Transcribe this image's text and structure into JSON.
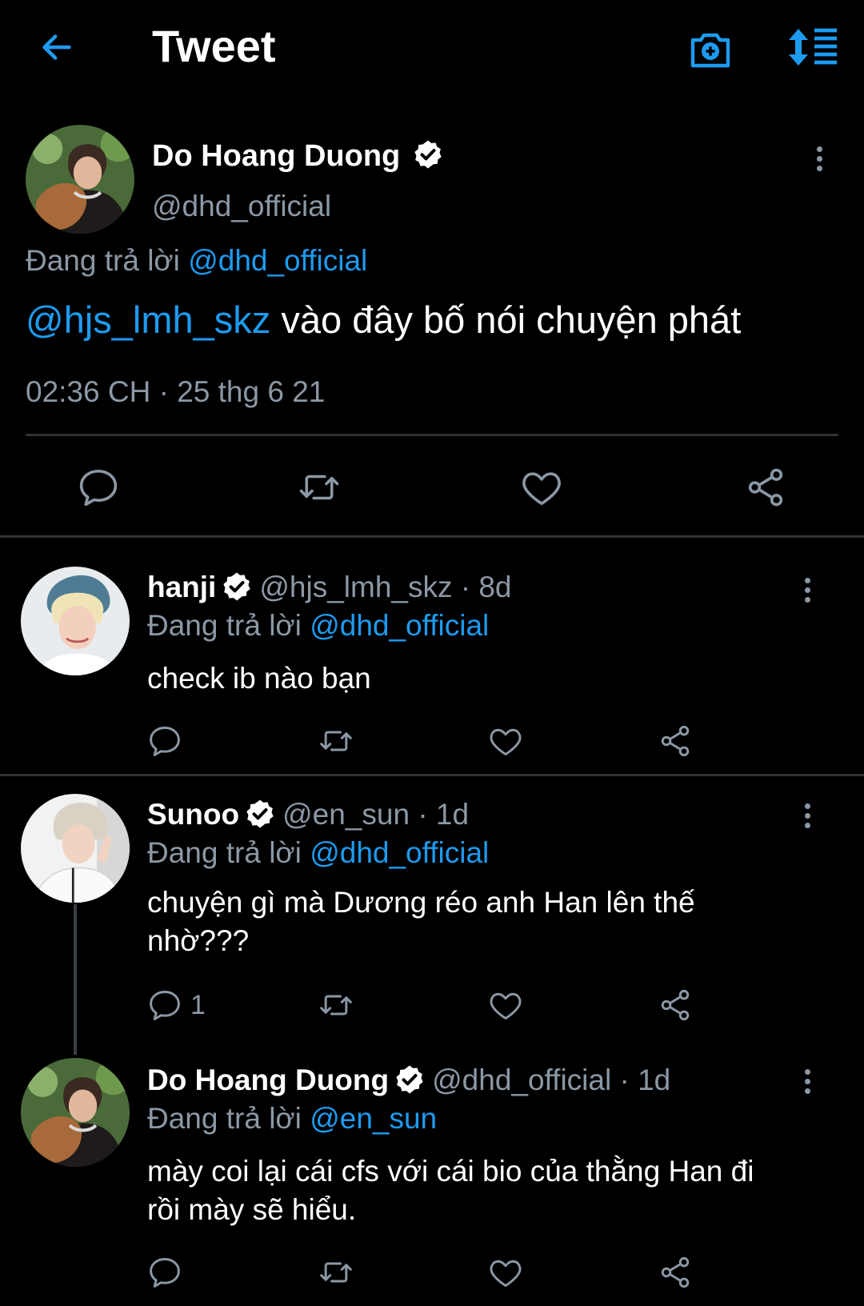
{
  "header": {
    "title": "Tweet"
  },
  "main_tweet": {
    "author_name": "Do Hoang Duong",
    "handle": "@dhd_official",
    "reply_prefix": "Đang trả lời",
    "reply_to": "@dhd_official",
    "mention": "@hjs_lmh_skz",
    "text": " vào đây bố nói chuyện phát",
    "timestamp": "02:36 CH · 25 thg 6 21"
  },
  "replies": [
    {
      "author_name": "hanji",
      "meta": "@hjs_lmh_skz · 8d",
      "reply_prefix": "Đang trả lời",
      "reply_to": "@dhd_official",
      "text_line1": "check ib nào bạn",
      "text_line2": "",
      "reply_count": ""
    },
    {
      "author_name": "Sunoo",
      "meta": "@en_sun · 1d",
      "reply_prefix": "Đang trả lời",
      "reply_to": "@dhd_official",
      "text_line1": "chuyện gì mà Dương réo anh Han lên thế",
      "text_line2": "nhờ???",
      "reply_count": "1"
    },
    {
      "author_name": "Do Hoang Duong",
      "meta": "@dhd_official · 1d",
      "reply_prefix": "Đang trả lời",
      "reply_to": "@en_sun",
      "text_line1": "mày coi lại cái cfs với cái bio của thằng Han đi",
      "text_line2": "rồi mày sẽ hiểu.",
      "reply_count": ""
    }
  ],
  "colors": {
    "accent": "#1d9bf0",
    "muted": "#8b98a5",
    "divider": "#2f3336",
    "background": "#000000"
  },
  "icons": [
    "back-arrow-icon",
    "camera-plus-icon",
    "sort-icon",
    "verified-badge-icon",
    "more-icon",
    "reply-icon",
    "retweet-icon",
    "like-icon",
    "share-icon"
  ]
}
